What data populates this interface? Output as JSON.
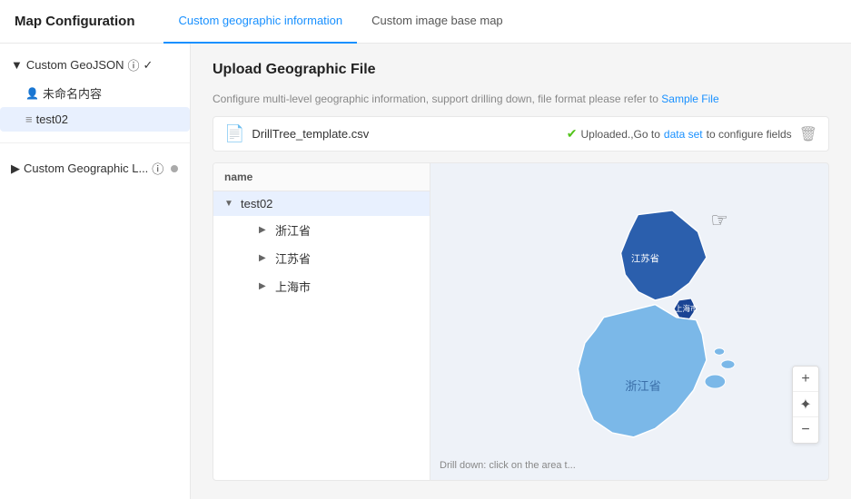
{
  "header": {
    "title": "Map Configuration",
    "tabs": [
      {
        "id": "geo",
        "label": "Custom geographic information",
        "active": true
      },
      {
        "id": "img",
        "label": "Custom image base map",
        "active": false
      }
    ]
  },
  "sidebar": {
    "sections": [
      {
        "label": "Custom GeoJSON",
        "expanded": true,
        "has_info": true,
        "has_badge": true,
        "items": [
          {
            "label": "未命名内容",
            "icon": "user",
            "indent": 1
          },
          {
            "label": "test02",
            "icon": "stack",
            "indent": 1,
            "selected": true
          }
        ]
      },
      {
        "label": "Custom Geographic L...",
        "expanded": false,
        "has_info": true,
        "has_dot": true
      }
    ]
  },
  "content": {
    "upload_title": "Upload Geographic File",
    "upload_desc": "Configure multi-level geographic information, support drilling down, file format please refer to",
    "sample_link": "Sample File",
    "file": {
      "name": "DrillTree_template.csv",
      "status": "Uploaded.,Go to",
      "status_link": "data set",
      "status_suffix": "to configure fields"
    },
    "tree": {
      "header": "name",
      "rows": [
        {
          "label": "test02",
          "indent": 0,
          "expanded": true,
          "has_arrow": true,
          "selected": true
        },
        {
          "label": "浙江省",
          "indent": 1,
          "has_arrow": true
        },
        {
          "label": "江苏省",
          "indent": 1,
          "has_arrow": true
        },
        {
          "label": "上海市",
          "indent": 1,
          "has_arrow": true
        }
      ]
    },
    "map": {
      "drill_text": "Drill down: click on the area t...",
      "region_jiangsu_label": "江苏省",
      "region_shanghai_label": "上海市",
      "region_zhejiang_label": "浙江省"
    }
  }
}
